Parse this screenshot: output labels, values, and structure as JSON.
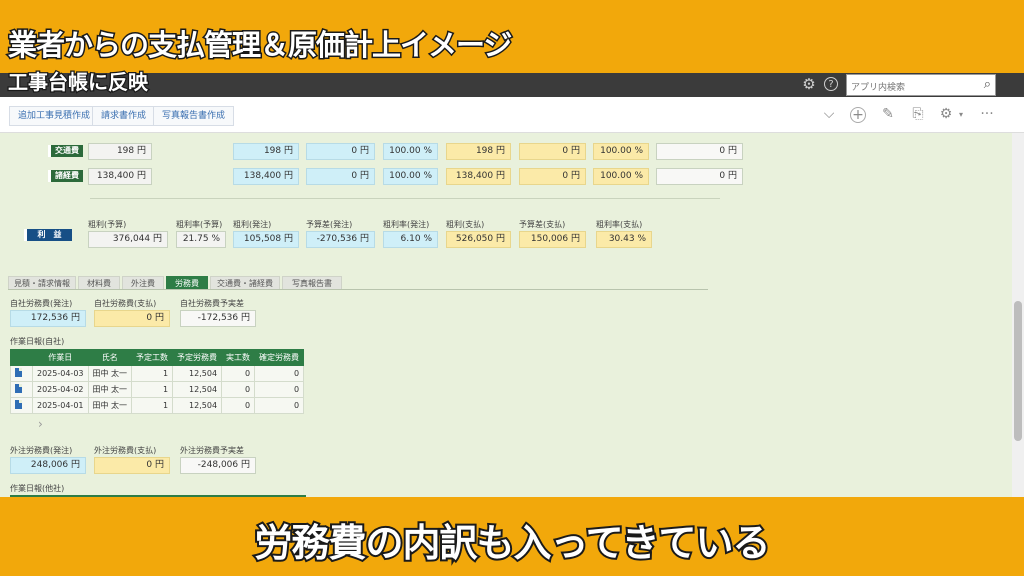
{
  "overlay": {
    "title": "業者からの支払管理＆原価計上イメージ",
    "subtitle": "工事台帳に反映",
    "caption": "労務費の内訳も入ってきている"
  },
  "topbar": {
    "gear_icon": "⚙",
    "help_icon": "?",
    "search_placeholder": "アプリ内検索",
    "search_icon": "⌕"
  },
  "actions": {
    "buttons": [
      "追加工事見積作成",
      "請求書作成",
      "写真報告書作成"
    ],
    "icons": {
      "chevron": "⌵",
      "plus": "+",
      "edit": "✎",
      "copy": "⎘",
      "gear": "⚙",
      "gear_caret": "▾",
      "more": "···"
    }
  },
  "rows": [
    {
      "label": "交通費",
      "v1": "198 円",
      "v2": "198 円",
      "v3": "0 円",
      "v4": "100.00 %",
      "v5": "198 円",
      "v6": "0 円",
      "v7": "100.00 %",
      "v8": "0 円"
    },
    {
      "label": "諸経費",
      "v1": "138,400 円",
      "v2": "138,400 円",
      "v3": "0 円",
      "v4": "100.00 %",
      "v5": "138,400 円",
      "v6": "0 円",
      "v7": "100.00 %",
      "v8": "0 円"
    }
  ],
  "profit": {
    "label": "利　益",
    "fields": [
      {
        "label": "粗利(予算)",
        "value": "376,044 円"
      },
      {
        "label": "粗利率(予算)",
        "value": "21.75 %"
      },
      {
        "label": "粗利(発注)",
        "value": "105,508 円"
      },
      {
        "label": "予算差(発注)",
        "value": "-270,536 円"
      },
      {
        "label": "粗利率(発注)",
        "value": "6.10 %"
      },
      {
        "label": "粗利(支払)",
        "value": "526,050 円"
      },
      {
        "label": "予算差(支払)",
        "value": "150,006 円"
      },
      {
        "label": "粗利率(支払)",
        "value": "30.43 %"
      }
    ]
  },
  "tabs": [
    "見積・請求情報",
    "材料費",
    "外注費",
    "労務費",
    "交通費・諸経費",
    "写真報告書"
  ],
  "own_labor": {
    "labels": [
      "自社労務費(発注)",
      "自社労務費(支払)",
      "自社労務費予実差"
    ],
    "values": [
      "172,536 円",
      "0 円",
      "-172,536 円"
    ]
  },
  "daily_report": {
    "title": "作業日報(自社)",
    "headers": [
      "作業日",
      "氏名",
      "予定工数",
      "予定労務費",
      "実工数",
      "確定労務費"
    ],
    "rows": [
      [
        "2025-04-03",
        "田中 太一",
        "1",
        "12,504",
        "0",
        "0"
      ],
      [
        "2025-04-02",
        "田中 太一",
        "1",
        "12,504",
        "0",
        "0"
      ],
      [
        "2025-04-01",
        "田中 太一",
        "1",
        "12,504",
        "0",
        "0"
      ]
    ],
    "pager": "›"
  },
  "outsourced_labor": {
    "labels": [
      "外注労務費(発注)",
      "外注労務費(支払)",
      "外注労務費予実差"
    ],
    "values": [
      "248,006 円",
      "0 円",
      "-248,006 円"
    ]
  },
  "daily_report_other": {
    "title": "作業日報(他社)"
  },
  "colors": {
    "accent_green": "#2e7d46",
    "frame_yellow": "#f2a80b",
    "navy": "#174f86"
  }
}
